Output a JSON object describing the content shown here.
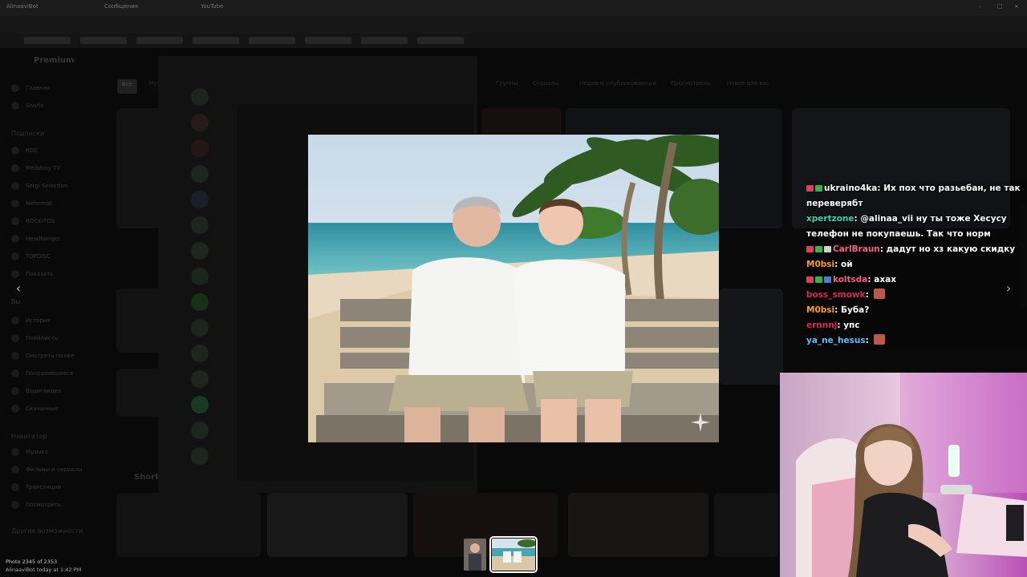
{
  "browser": {
    "tabs": [
      "AlinaaviBot",
      "Сообщения",
      "YouTube"
    ],
    "window_controls": [
      "–",
      "□",
      "×"
    ]
  },
  "youtube": {
    "logo_label": "Premium",
    "sidebar": {
      "top_items": [
        "Главная",
        "Shorts"
      ],
      "subscriptions_heading": "Подписки",
      "subscriptions": [
        "RDC",
        "Mellstroy TV",
        "Sergi Selection",
        "Neformat",
        "ROCKITOS",
        "Headbanger",
        "TOPDISC",
        "Показать"
      ],
      "you_heading": "Вы",
      "you_items": [
        "История",
        "Плейлисты",
        "Смотреть позже",
        "Понравившиеся",
        "Ваши видео",
        "Скачанные"
      ],
      "navigator_heading": "Навигатор",
      "navigator_items": [
        "Музыка",
        "Фильмы и сериалы",
        "Трансляции",
        "Посмотреть"
      ],
      "other_heading": "Другие возможности"
    },
    "chips": [
      "Все",
      "Музыка",
      "Группы",
      "Сериалы",
      "Недавно опубликованные",
      "Просмотрено",
      "Новое для вас"
    ],
    "shorts_heading": "Shorts"
  },
  "viewer": {
    "counter": "Photo 2345 of 2353",
    "meta": "AlinaaviBot  today at 1:42 PM",
    "prev_arrow": "‹",
    "next_arrow": "›"
  },
  "chat": {
    "messages": [
      {
        "user": "ukraino4ka",
        "user_color": "#ffffff",
        "badges": [
          "#e53b5a",
          "#3fae49"
        ],
        "text": "Их пох что разьебан, не так переверябт",
        "emote": false
      },
      {
        "user": "xpertzone",
        "user_color": "#38d6a9",
        "badges": [],
        "text": "@alinaa_vii ну ты тоже Хесусу телефон не покупаешь. Так что норм",
        "emote": false
      },
      {
        "user": "CarlBraun",
        "user_color": "#ff5f86",
        "badges": [
          "#e53b5a",
          "#3fae49",
          "#cfd0d4"
        ],
        "text": "дадут но хз какую скидку",
        "emote": false
      },
      {
        "user": "M0bsi",
        "user_color": "#ff9f1a",
        "badges": [],
        "text": "ой",
        "emote": false
      },
      {
        "user": "koltsda",
        "user_color": "#ff5f86",
        "badges": [
          "#e53b5a",
          "#3fae49",
          "#4a7bd6"
        ],
        "text": "ахах",
        "emote": false
      },
      {
        "user": "boss_smowk",
        "user_color": "#e0245e",
        "badges": [],
        "text": "",
        "emote": true
      },
      {
        "user": "M0bsi",
        "user_color": "#ff9f1a",
        "badges": [],
        "text": "Буба?",
        "emote": false
      },
      {
        "user": "ernnnj",
        "user_color": "#e0245e",
        "badges": [],
        "text": "упс",
        "emote": false
      },
      {
        "user": "ya_ne_hesus",
        "user_color": "#59c2ff",
        "badges": [],
        "text": "",
        "emote": true
      }
    ]
  },
  "colors": {
    "overlay_dim": "#000000",
    "chat_text": "#ffffff"
  }
}
